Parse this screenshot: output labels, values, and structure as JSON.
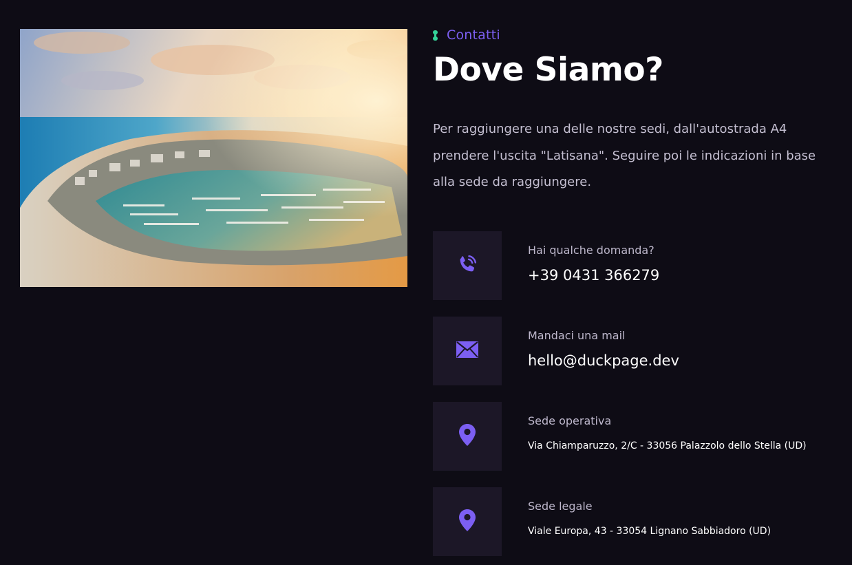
{
  "photo": {
    "alt": "Aerial view of a coastal town with a marina"
  },
  "section": {
    "eyebrow": "Contatti",
    "title": "Dove Siamo?",
    "intro": "Per raggiungere una delle nostre sedi, dall'autostrada A4 prendere l'uscita \"Latisana\". Seguire poi le indicazioni in base alla sede da raggiungere."
  },
  "contacts": [
    {
      "icon": "phone-call-icon",
      "label": "Hai qualche domanda?",
      "value": "+39 0431 366279"
    },
    {
      "icon": "mail-icon",
      "label": "Mandaci una mail",
      "value": "hello@duckpage.dev"
    },
    {
      "icon": "location-pin-icon",
      "label": "Sede operativa",
      "value": "Via Chiamparuzzo, 2/C - 33056 Palazzolo dello Stella (UD)"
    },
    {
      "icon": "location-pin-icon",
      "label": "Sede legale",
      "value": "Viale Europa, 43 - 33054 Lignano Sabbiadoro (UD)"
    }
  ],
  "colors": {
    "background": "#0e0c15",
    "accent": "#7c5ff2",
    "eyebrow_mark": "#34d399",
    "icon_box": "#1c1727"
  }
}
